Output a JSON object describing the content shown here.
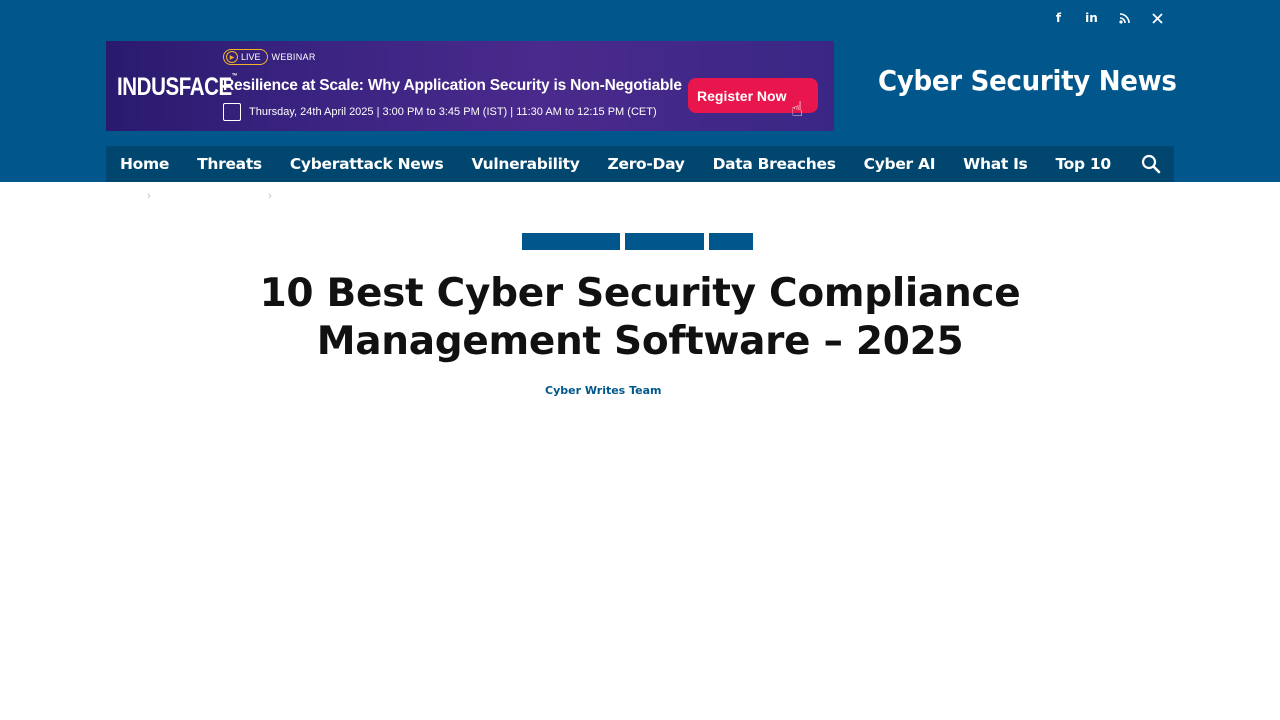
{
  "social": {
    "icons": [
      "facebook-icon",
      "linkedin-icon",
      "rss-icon",
      "x-icon"
    ],
    "glyphs": [
      "f",
      "in",
      "⌁",
      "𝕏"
    ]
  },
  "banner": {
    "brand": "INDUSFACE",
    "brand_tm": "™",
    "live": "LIVE",
    "webinar": "WEBINAR",
    "headline": "Resilience at Scale: Why Application Security is Non-Negotiable",
    "date": "Thursday, 24th April 2025 | 3:00 PM to 3:45 PM (IST) | 11:30 AM to 12:15 PM (CET)",
    "cta": "Register Now"
  },
  "site_title": "Cyber Security News",
  "nav": {
    "items": [
      "Home",
      "Threats",
      "Cyberattack News",
      "Vulnerability",
      "Zero-Day",
      "Data Breaches",
      "Cyber AI",
      "What Is",
      "Top 10"
    ]
  },
  "breadcrumb": {
    "separators": [
      "›",
      "›"
    ]
  },
  "article": {
    "title_line1": "10 Best Cyber Security Compliance",
    "title_line2": "Management Software – 2025",
    "author": "Cyber Writes Team"
  },
  "colors": {
    "header_bg": "#01578c",
    "nav_bg": "#01466f",
    "cta_bg": "#e8164c",
    "accent": "#01578c"
  }
}
